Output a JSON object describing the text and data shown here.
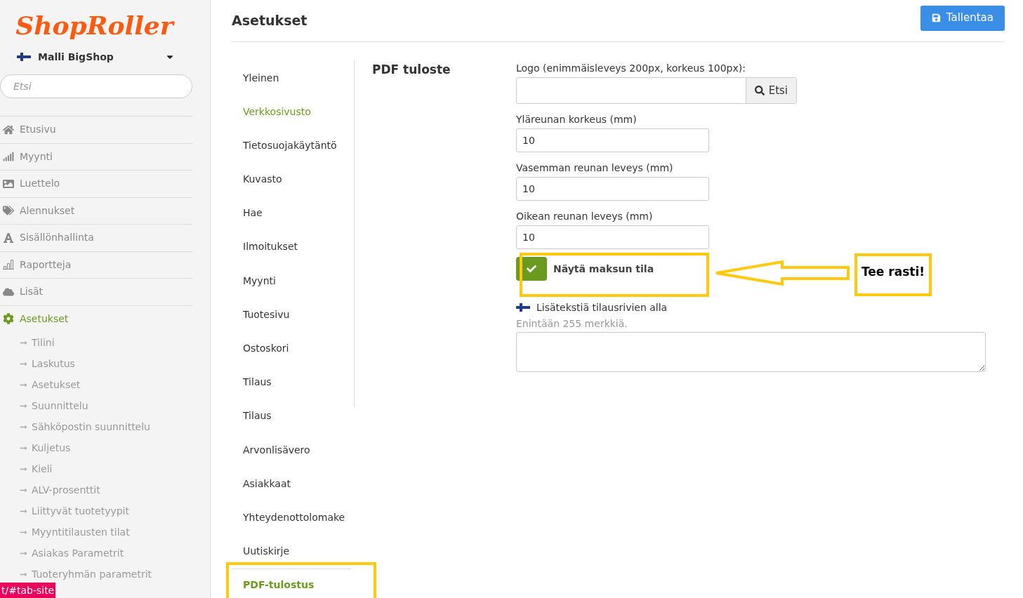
{
  "logo": "ShopRoller",
  "shop_selector": {
    "label": "Malli BigShop"
  },
  "search": {
    "placeholder": "Etsi"
  },
  "nav": [
    {
      "label": "Etusivu",
      "selected": false
    },
    {
      "label": "Myynti",
      "selected": false
    },
    {
      "label": "Luettelo",
      "selected": false
    },
    {
      "label": "Alennukset",
      "selected": false
    },
    {
      "label": "Sisällönhallinta",
      "selected": false
    },
    {
      "label": "Raportteja",
      "selected": false
    },
    {
      "label": "Lisät",
      "selected": false
    },
    {
      "label": "Asetukset",
      "selected": true,
      "children": [
        {
          "label": "Tilini"
        },
        {
          "label": "Laskutus"
        },
        {
          "label": "Asetukset"
        },
        {
          "label": "Suunnittelu"
        },
        {
          "label": "Sähköpostin suunnittelu"
        },
        {
          "label": "Kuljetus"
        },
        {
          "label": "Kieli"
        },
        {
          "label": "ALV-prosenttit"
        },
        {
          "label": "Liittyvät tuotetyypit"
        },
        {
          "label": "Myyntitilausten tilat"
        },
        {
          "label": "Asiakas Parametrit"
        },
        {
          "label": "Tuoteryhmän parametrit"
        }
      ]
    }
  ],
  "status_url": "t/#tab-site",
  "page_title": "Asetukset",
  "save_button": "Tallentaa",
  "tabs": [
    {
      "label": "Yleinen",
      "selected": false,
      "highlighted": false
    },
    {
      "label": "Verkkosivusto",
      "selected": false,
      "highlighted": true
    },
    {
      "label": "Tietosuojakäytäntö",
      "selected": false,
      "highlighted": false
    },
    {
      "label": "Kuvasto",
      "selected": false,
      "highlighted": false
    },
    {
      "label": "Hae",
      "selected": false,
      "highlighted": false
    },
    {
      "label": "Ilmoitukset",
      "selected": false,
      "highlighted": false
    },
    {
      "label": "Myynti",
      "selected": false,
      "highlighted": false
    },
    {
      "label": "Tuotesivu",
      "selected": false,
      "highlighted": false
    },
    {
      "label": "Ostoskori",
      "selected": false,
      "highlighted": false
    },
    {
      "label": "Tilaus",
      "selected": false,
      "highlighted": false
    },
    {
      "label": "Tilaus",
      "selected": false,
      "highlighted": false
    },
    {
      "label": "Arvonlisävero",
      "selected": false,
      "highlighted": false
    },
    {
      "label": "Asiakkaat",
      "selected": false,
      "highlighted": false
    },
    {
      "label": "Yhteydenottolomake",
      "selected": false,
      "highlighted": false
    },
    {
      "label": "Uutiskirje",
      "selected": false,
      "highlighted": false
    },
    {
      "label": "PDF-tulostus",
      "selected": true,
      "highlighted": true
    }
  ],
  "section_title": "PDF tuloste",
  "logo_field": {
    "label": "Logo (enimmäisleveys 200px, korkeus 100px):",
    "browse_button": "Etsi"
  },
  "fields": [
    {
      "label": "Yläreunan korkeus (mm)",
      "value": "10"
    },
    {
      "label": "Vasemman reunan leveys (mm)",
      "value": "10"
    },
    {
      "label": "Oikean reunan leveys (mm)",
      "value": "10"
    }
  ],
  "checkbox": {
    "label": "Näytä maksun tila",
    "checked": true
  },
  "extra_text": {
    "label": "Lisätekstiä tilausrivien alla",
    "hint": "Enintään 255 merkkiä."
  },
  "annotation": {
    "text": "Tee rasti!"
  }
}
